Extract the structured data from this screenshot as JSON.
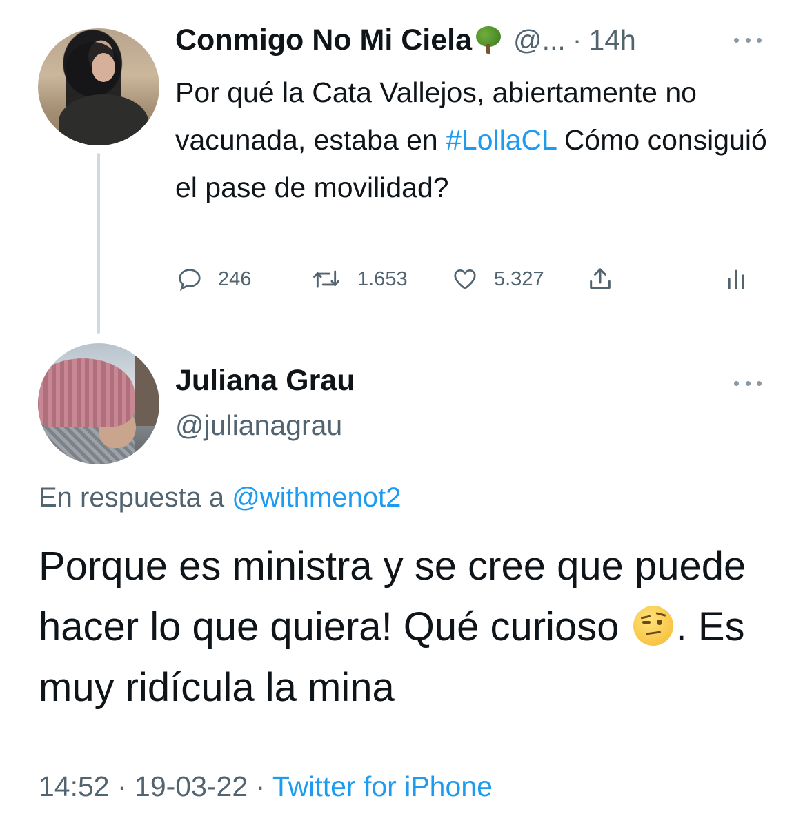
{
  "parent_tweet": {
    "display_name": "Conmigo No Mi Ciela",
    "name_emoji": "tree-emoji",
    "handle": "@...",
    "time": "14h",
    "separator": "·",
    "text_before": "Por qué la Cata Vallejos, abiertamente no vacunada, estaba en ",
    "hashtag": "#LollaCL",
    "text_after": " Cómo consiguió el pase de movilidad?",
    "replies": "246",
    "retweets": "1.653",
    "likes": "5.327"
  },
  "reply_tweet": {
    "display_name": "Juliana Grau",
    "handle": "@julianagrau",
    "reply_prefix": "En respuesta a ",
    "reply_mention": "@withmenot2",
    "text_part1": "Porque es ministra y se cree que puede hacer lo que quiera! Qué curioso ",
    "emoji": "face-with-raised-eyebrow",
    "text_part2": ". Es muy ridícula la mina",
    "timestamp": "14:52 · 19-03-22 · ",
    "source": "Twitter for iPhone"
  },
  "colors": {
    "link": "#1d9bf0",
    "secondary_text": "#536471",
    "primary_text": "#0f1419",
    "thread_line": "#cfd9de"
  },
  "icons": [
    "reply-icon",
    "retweet-icon",
    "like-icon",
    "share-icon",
    "analytics-icon",
    "more-icon"
  ]
}
